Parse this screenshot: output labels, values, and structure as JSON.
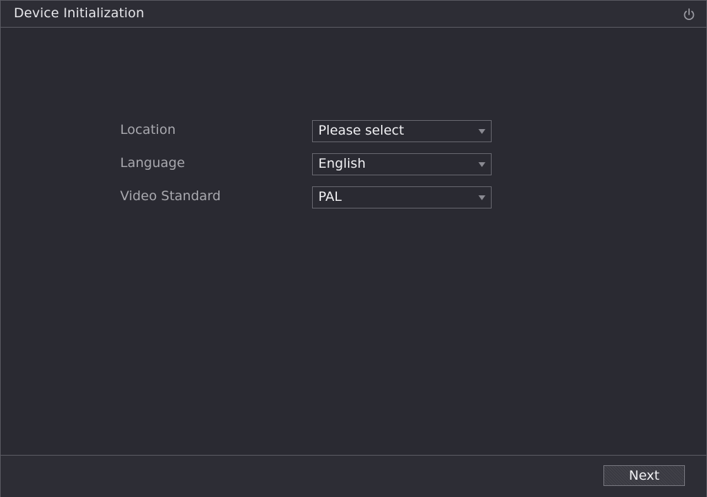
{
  "window": {
    "title": "Device Initialization"
  },
  "icons": {
    "power": "power-icon",
    "caret": "chevron-down-icon"
  },
  "form": {
    "location": {
      "label": "Location",
      "value": "Please select"
    },
    "language": {
      "label": "Language",
      "value": "English"
    },
    "video_standard": {
      "label": "Video Standard",
      "value": "PAL"
    }
  },
  "footer": {
    "next_label": "Next"
  },
  "colors": {
    "background": "#2a2a32",
    "border": "#5e5e66",
    "label_text": "#a8a8ae",
    "value_text": "#f0f0f3"
  }
}
